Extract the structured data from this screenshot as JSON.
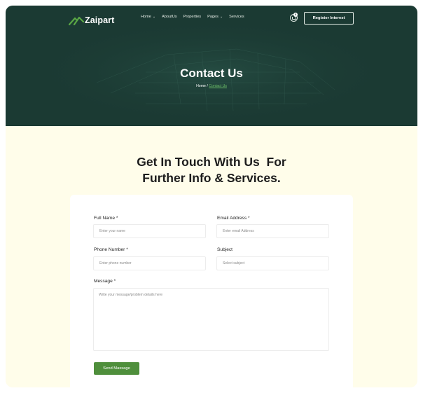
{
  "brand": {
    "name": "Zaipart"
  },
  "nav": {
    "items": [
      {
        "label": "Home",
        "has_dropdown": true
      },
      {
        "label": "AboutUs",
        "has_dropdown": false
      },
      {
        "label": "Properties",
        "has_dropdown": false
      },
      {
        "label": "Pages",
        "has_dropdown": true
      },
      {
        "label": "Services",
        "has_dropdown": false
      }
    ],
    "cart_count": "0",
    "register_label": "Register Interest"
  },
  "hero": {
    "title": "Contact Us",
    "breadcrumb_home": "Home",
    "breadcrumb_separator": "/",
    "breadcrumb_current": "Contact Us"
  },
  "section": {
    "heading_line1": "Get In Touch With Us  For",
    "heading_line2": "Further Info & Services."
  },
  "form": {
    "full_name": {
      "label": "Full Name",
      "required_mark": "*",
      "placeholder": "Enter your name"
    },
    "email": {
      "label": "Email Address",
      "required_mark": "*",
      "placeholder": "Enter email Address"
    },
    "phone": {
      "label": "Phone Number",
      "required_mark": "*",
      "placeholder": "Enter phone number"
    },
    "subject": {
      "label": "Subject",
      "value": "Select subject"
    },
    "message": {
      "label": "Message",
      "required_mark": "*",
      "placeholder": "Write your message/problem details here"
    },
    "submit_label": "Send Massage"
  },
  "colors": {
    "header_bg": "#1b3a33",
    "accent_green": "#4f8f3c",
    "page_bg": "#fffdea"
  }
}
